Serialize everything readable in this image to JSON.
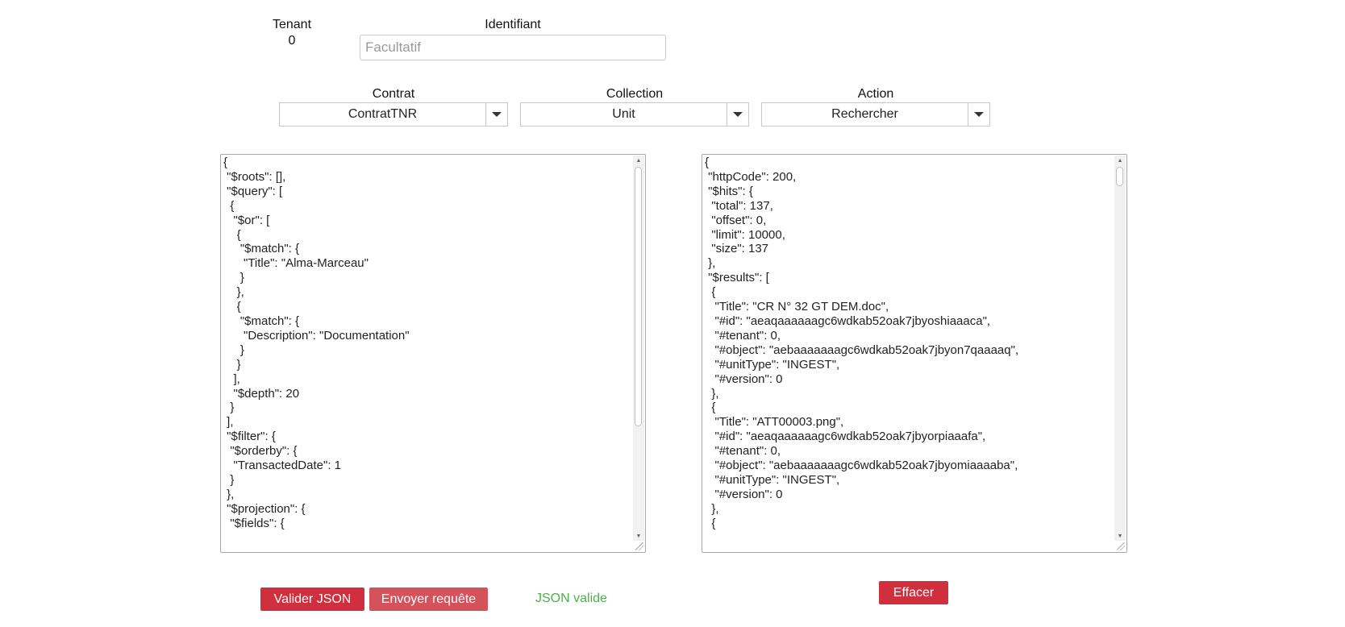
{
  "tenant": {
    "label": "Tenant",
    "value": "0"
  },
  "identifier": {
    "label": "Identifiant",
    "placeholder": "Facultatif"
  },
  "contract": {
    "label": "Contrat",
    "selected": "ContratTNR"
  },
  "collection": {
    "label": "Collection",
    "selected": "Unit"
  },
  "action": {
    "label": "Action",
    "selected": "Rechercher"
  },
  "query_editor": {
    "content": "{\n \"$roots\": [],\n \"$query\": [\n  {\n   \"$or\": [\n    {\n     \"$match\": {\n      \"Title\": \"Alma-Marceau\"\n     }\n    },\n    {\n     \"$match\": {\n      \"Description\": \"Documentation\"\n     }\n    }\n   ],\n   \"$depth\": 20\n  }\n ],\n \"$filter\": {\n  \"$orderby\": {\n   \"TransactedDate\": 1\n  }\n },\n \"$projection\": {\n  \"$fields\": {"
  },
  "response_viewer": {
    "content": "{\n \"httpCode\": 200,\n \"$hits\": {\n  \"total\": 137,\n  \"offset\": 0,\n  \"limit\": 10000,\n  \"size\": 137\n },\n \"$results\": [\n  {\n   \"Title\": \"CR N° 32 GT DEM.doc\",\n   \"#id\": \"aeaqaaaaaagc6wdkab52oak7jbyoshiaaaca\",\n   \"#tenant\": 0,\n   \"#object\": \"aebaaaaaaagc6wdkab52oak7jbyon7qaaaaq\",\n   \"#unitType\": \"INGEST\",\n   \"#version\": 0\n  },\n  {\n   \"Title\": \"ATT00003.png\",\n   \"#id\": \"aeaqaaaaaagc6wdkab52oak7jbyorpiaaafa\",\n   \"#tenant\": 0,\n   \"#object\": \"aebaaaaaaagc6wdkab52oak7jbyomiaaaaba\",\n   \"#unitType\": \"INGEST\",\n   \"#version\": 0\n  },\n  {"
  },
  "buttons": {
    "validate": "Valider JSON",
    "send": "Envoyer requête",
    "clear": "Effacer"
  },
  "status": {
    "message": "JSON valide",
    "color": "#4caf50"
  },
  "colors": {
    "primary_button": "#d0303e",
    "secondary_button": "#d4525c"
  }
}
